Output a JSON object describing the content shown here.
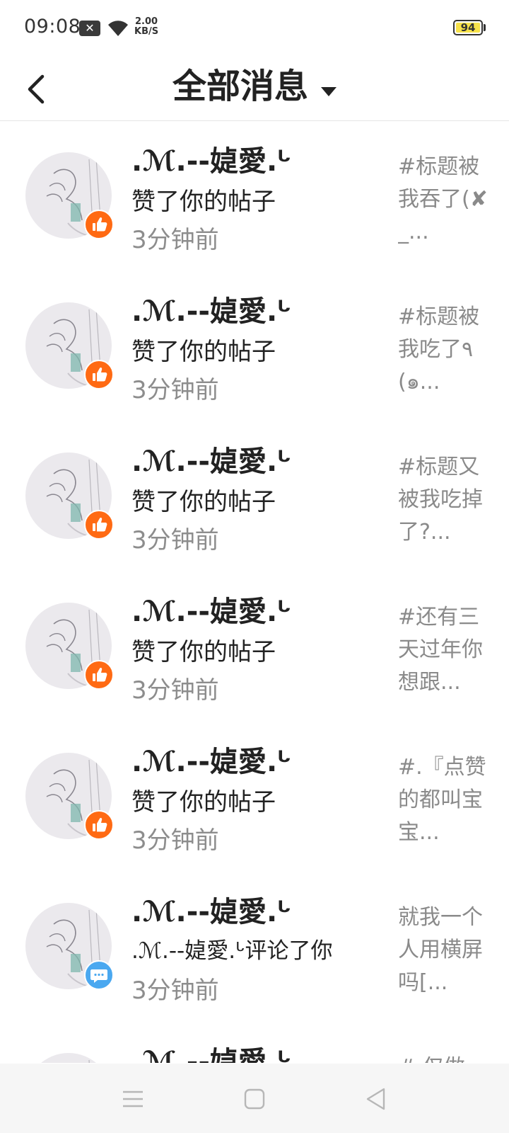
{
  "status_bar": {
    "time": "09:08",
    "speed_value": "2.00",
    "speed_unit": "KB/S",
    "battery": "94",
    "notification_icon": "close-square-icon",
    "wifi_icon": "wifi-icon"
  },
  "header": {
    "back_icon": "chevron-left-icon",
    "title": "全部消息",
    "dropdown_icon": "caret-down-icon"
  },
  "messages": [
    {
      "name": ".ℳ.--媫愛.ᒡ",
      "action": "赞了你的帖子",
      "time": "3分钟前",
      "preview": "#标题被我吞了(✘_...",
      "badge": "like"
    },
    {
      "name": ".ℳ.--媫愛.ᒡ",
      "action": "赞了你的帖子",
      "time": "3分钟前",
      "preview": "#标题被我吃了٩(๑...",
      "badge": "like"
    },
    {
      "name": ".ℳ.--媫愛.ᒡ",
      "action": "赞了你的帖子",
      "time": "3分钟前",
      "preview": "#标题又被我吃掉了?...",
      "badge": "like"
    },
    {
      "name": ".ℳ.--媫愛.ᒡ",
      "action": "赞了你的帖子",
      "time": "3分钟前",
      "preview": "#还有三天过年你想跟...",
      "badge": "like"
    },
    {
      "name": ".ℳ.--媫愛.ᒡ",
      "action": "赞了你的帖子",
      "time": "3分钟前",
      "preview": "#.『点赞的都叫宝宝...",
      "badge": "like"
    },
    {
      "name": ".ℳ.--媫愛.ᒡ",
      "action": ".ℳ.--媫愛.ᒡ评论了你",
      "time": "3分钟前",
      "preview": "就我一个人用横屏吗[...",
      "badge": "comment"
    },
    {
      "name": ".ℳ.--媫愛.ᒡ",
      "action": "",
      "time": "",
      "preview": "#.仅做上...",
      "badge": "like"
    }
  ],
  "colors": {
    "like_badge": "#ff6a13",
    "comment_badge": "#4aa8f0",
    "secondary_text": "#8d8d8d"
  },
  "nav": {
    "menu_icon": "menu-icon",
    "home_icon": "square-home-icon",
    "back_icon": "triangle-back-icon"
  }
}
